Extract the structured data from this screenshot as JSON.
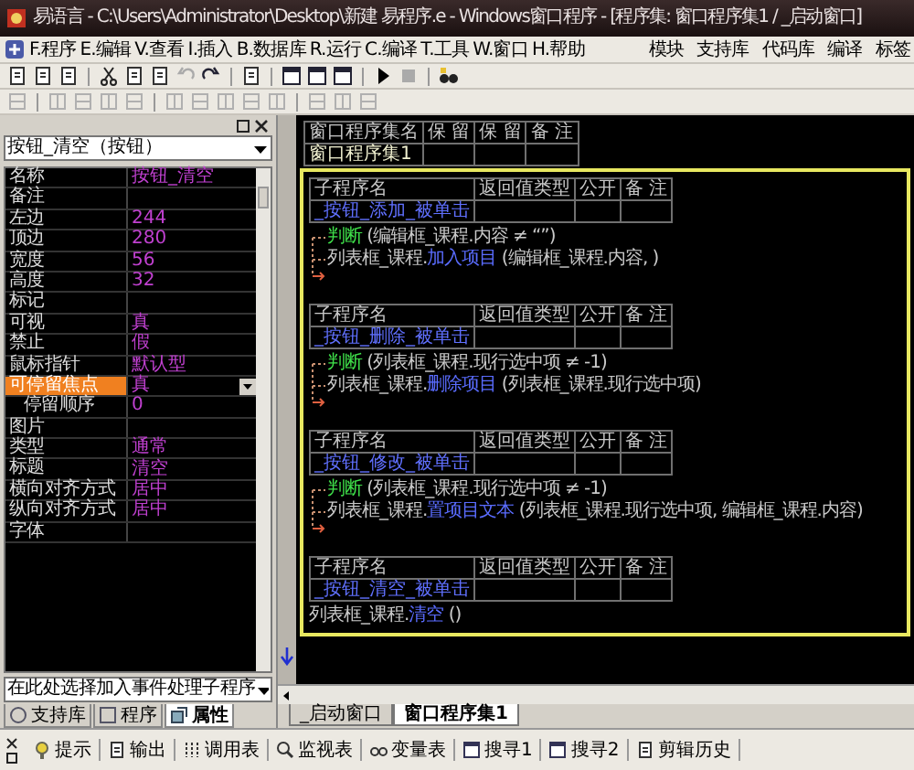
{
  "window": {
    "title": "易语言 - C:\\Users\\Administrator\\Desktop\\新建 易程序.e - Windows窗口程序 - [程序集: 窗口程序集1 / _启动窗口]"
  },
  "menu": [
    "F.程序",
    "E.编辑",
    "V.查看",
    "I.插入",
    "B.数据库",
    "R.运行",
    "C.编译",
    "T.工具",
    "W.窗口",
    "H.帮助"
  ],
  "menu_right": [
    "模块",
    "支持库",
    "代码库",
    "编译",
    "标签"
  ],
  "toolbar_1": [
    {
      "disabled": false
    },
    {
      "disabled": false
    },
    {
      "disabled": false
    },
    {
      "disabled": false
    },
    {
      "disabled": false
    },
    {
      "disabled": false
    },
    {
      "disabled": true
    },
    {
      "disabled": false
    },
    {
      "disabled": false
    },
    {
      "disabled": false
    },
    {
      "disabled": false
    },
    {
      "disabled": false
    },
    {
      "disabled": false
    },
    {
      "disabled": true
    },
    {
      "disabled": false
    }
  ],
  "toolbar_2": [
    {
      "disabled": true
    },
    {
      "disabled": true
    },
    {
      "disabled": true
    },
    {
      "disabled": true
    },
    {
      "disabled": true
    },
    {
      "disabled": true
    },
    {
      "disabled": true
    },
    {
      "disabled": true
    },
    {
      "disabled": true
    },
    {
      "disabled": true
    },
    {
      "disabled": true
    },
    {
      "disabled": true
    },
    {
      "disabled": true
    }
  ],
  "property_panel": {
    "object": "按钮_清空（按钮）",
    "properties": [
      {
        "name": "名称",
        "value": "按钮_清空",
        "selected": false
      },
      {
        "name": "备注",
        "selected": false
      },
      {
        "name": "左边",
        "value": "244",
        "selected": false
      },
      {
        "name": "顶边",
        "value": "280",
        "selected": false
      },
      {
        "name": "宽度",
        "value": "56",
        "selected": false
      },
      {
        "name": "高度",
        "value": "32",
        "selected": false
      },
      {
        "name": "标记",
        "selected": false
      },
      {
        "name": "可视",
        "value": "真",
        "selected": false
      },
      {
        "name": "禁止",
        "value": "假",
        "selected": false
      },
      {
        "name": "鼠标指针",
        "value": "默认型",
        "selected": false
      },
      {
        "name": "可停留焦点",
        "value": "真",
        "selected": true,
        "children": [
          {
            "name": "停留顺序",
            "value": "0",
            "selected": false
          }
        ]
      },
      {
        "name": "图片",
        "selected": false
      },
      {
        "name": "类型",
        "value": "通常",
        "selected": false
      },
      {
        "name": "标题",
        "value": "清空",
        "selected": false
      },
      {
        "name": "横向对齐方式",
        "value": "居中",
        "selected": false
      },
      {
        "name": "纵向对齐方式",
        "value": "居中",
        "selected": false
      },
      {
        "name": "字体",
        "selected": false
      }
    ],
    "event_selector": "在此处选择加入事件处理子程序",
    "tabs": [
      {
        "label": "支持库",
        "selected": false
      },
      {
        "label": "程序",
        "selected": false
      },
      {
        "label": "属性",
        "selected": true
      }
    ]
  },
  "editor": {
    "program_set_table": {
      "columns": [
        "窗口程序集名",
        "保 留",
        "保 留",
        "备 注"
      ],
      "name": "窗口程序集1"
    },
    "subroutines": [
      {
        "columns": [
          "子程序名",
          "返回值类型",
          "公开",
          "备 注"
        ],
        "name": "_按钮_添加_被单击",
        "flow": true,
        "lines": [
          [
            {
              "kind": "keyword",
              "text": "判断"
            },
            {
              "kind": "plain",
              "text": " (编辑框_课程.内容 ≠ “”)"
            }
          ],
          [
            {
              "kind": "plain",
              "text": "列表框_课程."
            },
            {
              "kind": "method",
              "text": "加入项目"
            },
            {
              "kind": "plain",
              "text": " (编辑框_课程.内容, )"
            }
          ]
        ]
      },
      {
        "columns": [
          "子程序名",
          "返回值类型",
          "公开",
          "备 注"
        ],
        "name": "_按钮_删除_被单击",
        "flow": true,
        "lines": [
          [
            {
              "kind": "keyword",
              "text": "判断"
            },
            {
              "kind": "plain",
              "text": " (列表框_课程.现行选中项 ≠ -1)"
            }
          ],
          [
            {
              "kind": "plain",
              "text": "列表框_课程."
            },
            {
              "kind": "method",
              "text": "删除项目"
            },
            {
              "kind": "plain",
              "text": " (列表框_课程.现行选中项)"
            }
          ]
        ]
      },
      {
        "columns": [
          "子程序名",
          "返回值类型",
          "公开",
          "备 注"
        ],
        "name": "_按钮_修改_被单击",
        "flow": true,
        "lines": [
          [
            {
              "kind": "keyword",
              "text": "判断"
            },
            {
              "kind": "plain",
              "text": " (列表框_课程.现行选中项 ≠ -1)"
            }
          ],
          [
            {
              "kind": "plain",
              "text": "列表框_课程."
            },
            {
              "kind": "method",
              "text": "置项目文本"
            },
            {
              "kind": "plain",
              "text": " (列表框_课程.现行选中项, 编辑框_课程.内容)"
            }
          ]
        ]
      },
      {
        "columns": [
          "子程序名",
          "返回值类型",
          "公开",
          "备 注"
        ],
        "name": "_按钮_清空_被单击",
        "flow": false,
        "lines": [
          [
            {
              "kind": "plain",
              "text": "列表框_课程."
            },
            {
              "kind": "method",
              "text": "清空"
            },
            {
              "kind": "plain",
              "text": " ()"
            }
          ]
        ]
      }
    ],
    "tabs": [
      {
        "label": "_启动窗口",
        "selected": false
      },
      {
        "label": "窗口程序集1",
        "selected": true
      }
    ]
  },
  "bottom_tabs": [
    "提示",
    "输出",
    "调用表",
    "监视表",
    "变量表",
    "搜寻1",
    "搜寻2",
    "剪辑历史"
  ]
}
